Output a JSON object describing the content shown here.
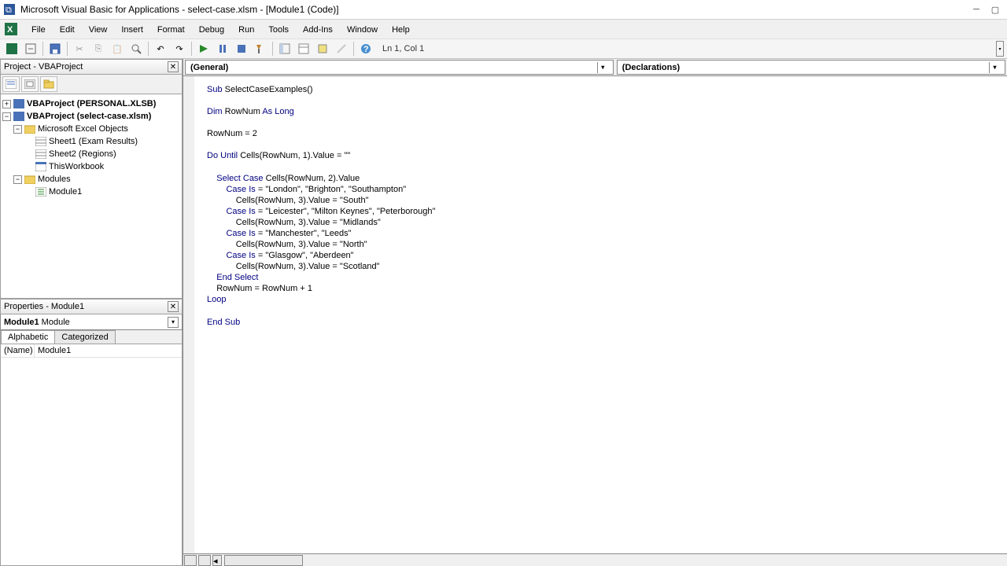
{
  "window": {
    "title": "Microsoft Visual Basic for Applications - select-case.xlsm - [Module1 (Code)]"
  },
  "menu": {
    "file": "File",
    "edit": "Edit",
    "view": "View",
    "insert": "Insert",
    "format": "Format",
    "debug": "Debug",
    "run": "Run",
    "tools": "Tools",
    "addins": "Add-Ins",
    "window": "Window",
    "help": "Help"
  },
  "toolbar": {
    "cursor_pos": "Ln 1, Col 1"
  },
  "project_panel": {
    "title": "Project - VBAProject",
    "nodes": {
      "personal": "VBAProject (PERSONAL.XLSB)",
      "selectcase": "VBAProject (select-case.xlsm)",
      "excel_objects": "Microsoft Excel Objects",
      "sheet1": "Sheet1 (Exam Results)",
      "sheet2": "Sheet2 (Regions)",
      "thiswb": "ThisWorkbook",
      "modules": "Modules",
      "module1": "Module1"
    }
  },
  "properties_panel": {
    "title": "Properties - Module1",
    "module_bold": "Module1",
    "module_type": " Module",
    "tabs": {
      "alpha": "Alphabetic",
      "cat": "Categorized"
    },
    "row1_name": "(Name)",
    "row1_val": "Module1"
  },
  "code_selectors": {
    "left": "(General)",
    "right": "(Declarations)"
  },
  "code": {
    "lines": [
      "Sub SelectCaseExamples()",
      "",
      "Dim RowNum As Long",
      "",
      "RowNum = 2",
      "",
      "Do Until Cells(RowNum, 1).Value = \"\"",
      "",
      "    Select Case Cells(RowNum, 2).Value",
      "        Case Is = \"London\", \"Brighton\", \"Southampton\"",
      "            Cells(RowNum, 3).Value = \"South\"",
      "        Case Is = \"Leicester\", \"Milton Keynes\", \"Peterborough\"",
      "            Cells(RowNum, 3).Value = \"Midlands\"",
      "        Case Is = \"Manchester\", \"Leeds\"",
      "            Cells(RowNum, 3).Value = \"North\"",
      "        Case Is = \"Glasgow\", \"Aberdeen\"",
      "            Cells(RowNum, 3).Value = \"Scotland\"",
      "    End Select",
      "    RowNum = RowNum + 1",
      "Loop",
      "",
      "End Sub"
    ]
  }
}
